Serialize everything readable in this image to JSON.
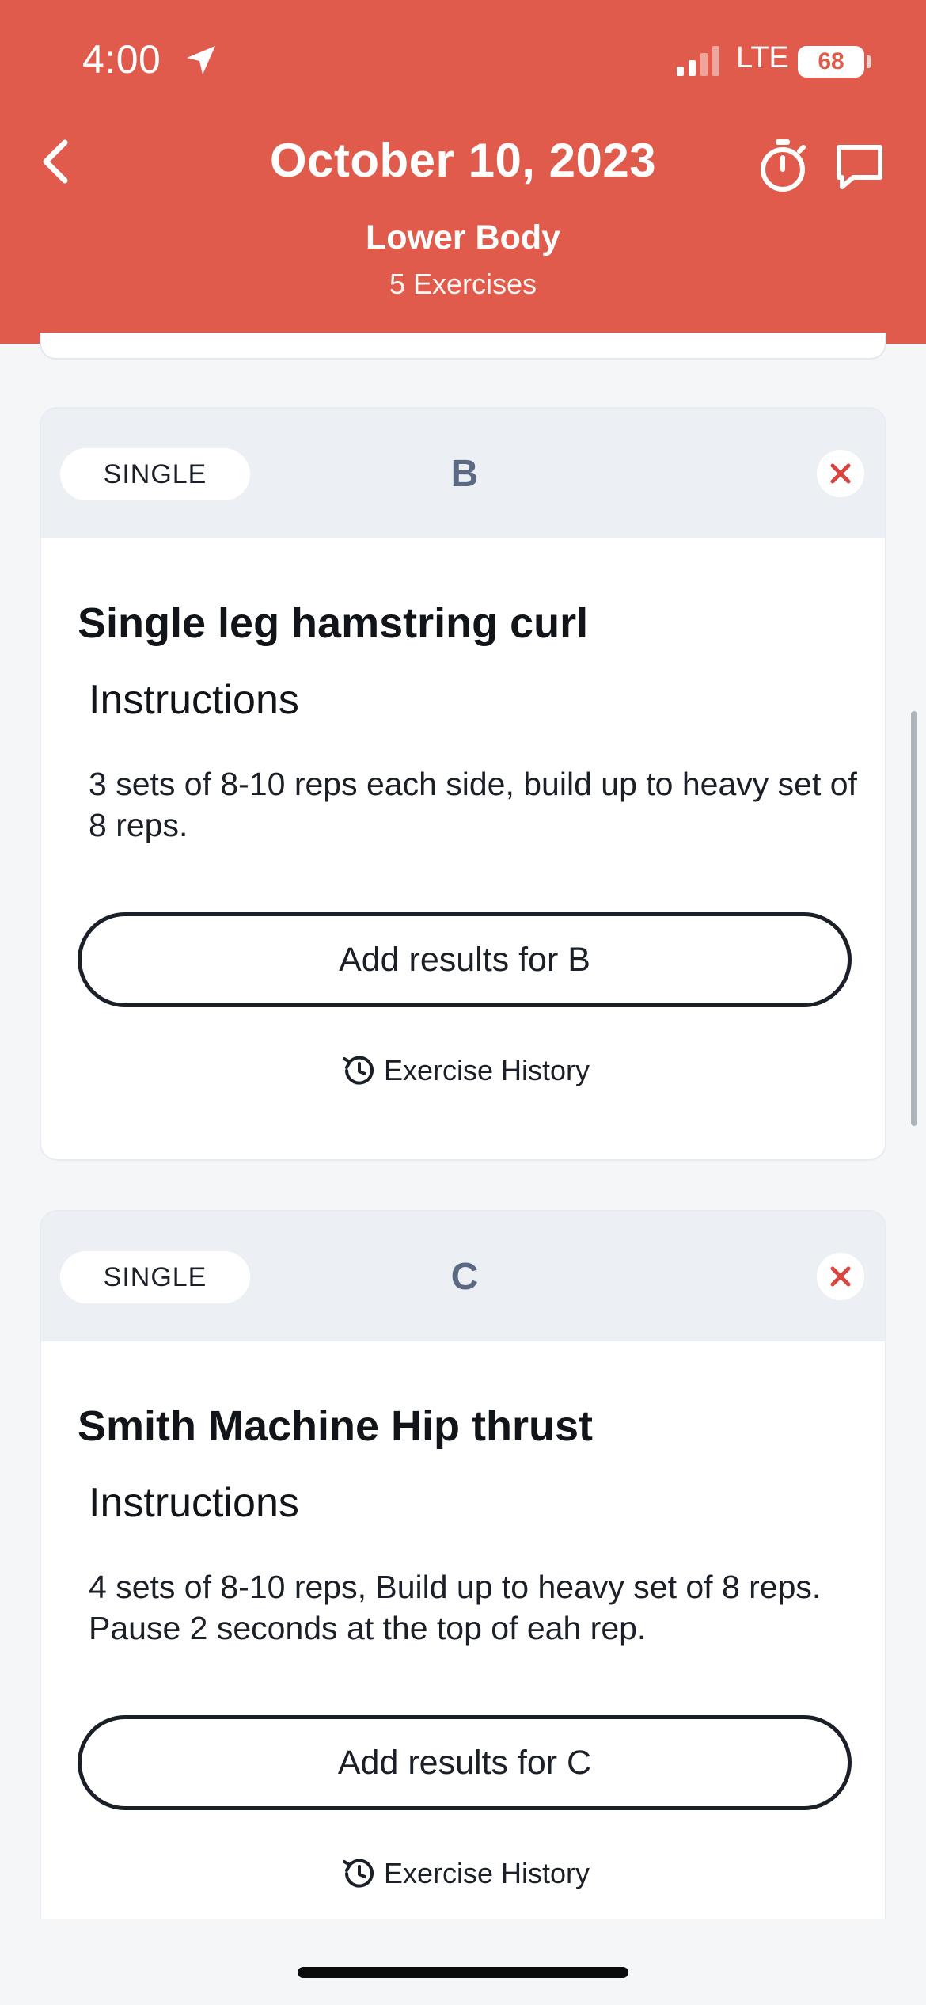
{
  "status_bar": {
    "time": "4:00",
    "network": "LTE",
    "battery": "68"
  },
  "header": {
    "title": "October 10, 2023",
    "subtitle": "Lower Body",
    "count": "5 Exercises",
    "back_icon": "chevron-left-icon",
    "timer_icon": "stopwatch-icon",
    "chat_icon": "chat-bubble-icon"
  },
  "colors": {
    "header_bg": "#e05b4b",
    "card_head_bg": "#eceff4",
    "letter_color": "#5b6a82",
    "close_color": "#d8453f"
  },
  "exercises": [
    {
      "type": "SINGLE",
      "letter": "B",
      "name": "Single leg hamstring curl",
      "instructions_heading": "Instructions",
      "instructions": "3 sets of 8-10 reps each side, build up to heavy set of 8 reps.",
      "add_label": "Add results for B",
      "history_label": "Exercise History"
    },
    {
      "type": "SINGLE",
      "letter": "C",
      "name": "Smith Machine Hip thrust",
      "instructions_heading": "Instructions",
      "instructions": "4 sets of 8-10 reps, Build up to heavy set of 8 reps. Pause 2 seconds at the top of eah rep.",
      "add_label": "Add results for C",
      "history_label": "Exercise History"
    }
  ]
}
